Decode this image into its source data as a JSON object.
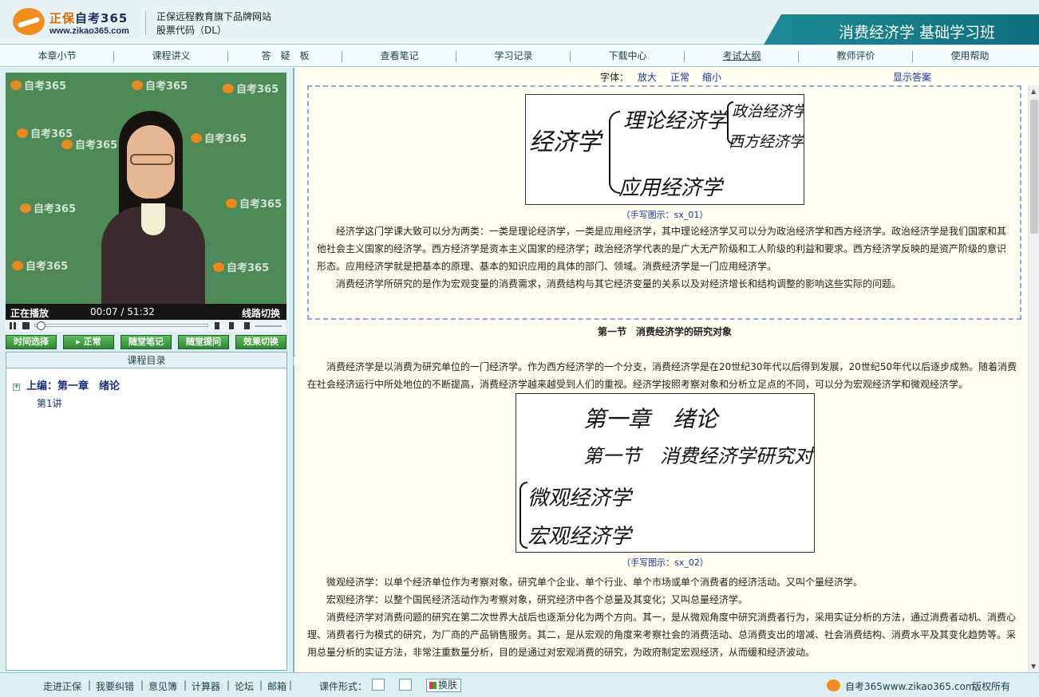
{
  "header": {
    "brand_primary": "正保",
    "brand_secondary": "自考365",
    "url": "www.zikao365.com",
    "tagline": "正保远程教育旗下品牌网站",
    "stock_code": "股票代码（DL）",
    "course_title": "消费经济学 基础学习班"
  },
  "nav": {
    "items": [
      {
        "label": "本章小节"
      },
      {
        "label": "课程讲义"
      },
      {
        "label": "答　疑　板"
      },
      {
        "label": "查看笔记"
      },
      {
        "label": "学习记录"
      },
      {
        "label": "下载中心"
      },
      {
        "label": "考试大纲"
      },
      {
        "label": "教师评价"
      },
      {
        "label": "使用帮助"
      }
    ]
  },
  "video": {
    "watermark": "自考365",
    "watermark_url": "www.zikao365.com",
    "status": "正在播放",
    "current_time": "00:07",
    "time_sep": "/",
    "duration": "51:32",
    "line_switch": "线路切换",
    "progress_fraction": 0.01
  },
  "player_buttons": [
    {
      "label": "时间选择"
    },
    {
      "label": "正常"
    },
    {
      "label": "随堂笔记"
    },
    {
      "label": "随堂提问"
    },
    {
      "label": "效果切换"
    }
  ],
  "toc": {
    "header": "课程目录",
    "chapter": "上编：第一章　绪论",
    "lesson": "第1讲"
  },
  "content": {
    "font_label": "字体：",
    "font_enlarge": "放大",
    "font_normal": "正常",
    "font_shrink": "缩小",
    "show_answer": "显示答案",
    "hw1": {
      "root": "经济学",
      "branch_theory": "理论经济学",
      "sub_political": "政治经济学",
      "sub_western": "西方经济学",
      "branch_applied": "应用经济学",
      "caption": "（手写图示：sx_01）"
    },
    "para1": "经济学这门学课大致可以分为两类：一类是理论经济学，一类是应用经济学，其中理论经济学又可以分为政治经济学和西方经济学。政治经济学是我们国家和其他社会主义国家的经济学。西方经济学是资本主义国家的经济学；政治经济学代表的是广大无产阶级和工人阶级的利益和要求。西方经济学反映的是资产阶级的意识形态。应用经济学就是把基本的原理、基本的知识应用的具体的部门、领域。消费经济学是一门应用经济学。",
    "para2": "消费经济学所研究的是作为宏观变量的消费需求，消费结构与其它经济变量的关系以及对经济增长和结构调整的影响这些实际的问题。",
    "section_title": "第一节　消费经济学的研究对象",
    "para3": "消费经济学是以消费为研究单位的一门经济学。作为西方经济学的一个分支，消费经济学是在20世纪30年代以后得到发展，20世纪50年代以后逐步成熟。随着消费在社会经济运行中所处地位的不断提高，消费经济学越来越受到人们的重视。经济学按照考察对象和分析立足点的不同，可以分为宏观经济学和微观经济学。",
    "hw2": {
      "line1": "第一章　绪论",
      "line2": "第一节　消费经济学研究对象",
      "micro": "微观经济学",
      "macro": "宏观经济学",
      "caption": "（手写图示：sx_02）"
    },
    "para4": "微观经济学：以单个经济单位作为考察对象，研究单个企业、单个行业、单个市场或单个消费者的经济活动。又叫个量经济学。",
    "para5": "宏观经济学：以整个国民经济活动作为考察对象，研究经济中各个总量及其变化；又叫总量经济学。",
    "para6": "消费经济学对消费问题的研究在第二次世界大战后也逐渐分化为两个方向。其一，是从微观角度中研究消费者行为，采用实证分析的方法，通过消费者动机、消费心理、消费者行为模式的研究，为厂商的产品销售服务。其二，是从宏观的角度来考察社会的消费活动、总消费支出的增减、社会消费结构、消费水平及其变化趋势等。采用总量分析的实证方法，非常注重数量分析，目的是通过对宏观消费的研究，为政府制定宏观经济，从而缓和经济波动。"
  },
  "footer": {
    "links": [
      {
        "label": "走进正保"
      },
      {
        "label": "我要纠错"
      },
      {
        "label": "意见簿"
      },
      {
        "label": "计算器"
      },
      {
        "label": "论坛"
      },
      {
        "label": "邮箱"
      }
    ],
    "separator": "|",
    "format_label": "课件形式：",
    "skin_label": "换肤",
    "site": "自考365www.zikao365.com",
    "copyright": "版权所有"
  },
  "colors": {
    "header_bg": "#e6f2f4",
    "banner": "#1d8a97",
    "brand_orange": "#f28c1c",
    "link_blue": "#1b2f9a",
    "content_bg": "#fffef0",
    "button_green": "#2f8a35"
  },
  "icons": [
    "logo-mark",
    "pause-icon",
    "stop-icon",
    "prev-icon",
    "next-icon",
    "volume-icon",
    "play-icon",
    "expand-icon",
    "collapse-icon",
    "format-single-icon",
    "format-split-icon",
    "skin-icon"
  ]
}
